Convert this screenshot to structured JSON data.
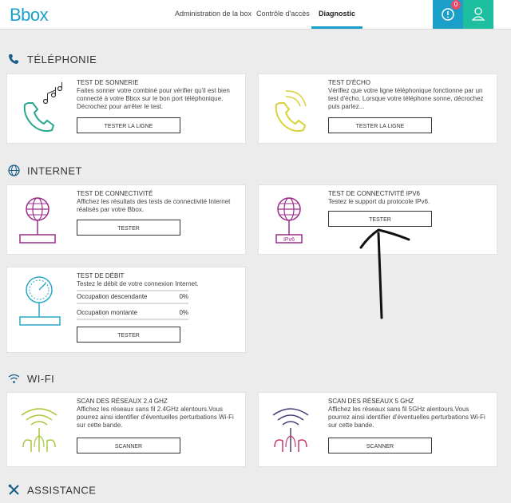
{
  "header": {
    "logo": "Bbox",
    "nav": [
      "Administration de la box",
      "Contrôle d'accès",
      "Diagnostic"
    ],
    "alert_count": "0",
    "colors": {
      "accent": "#1aa0c8",
      "user_button": "#1dbfa0",
      "badge": "#e84b6a"
    }
  },
  "sections": {
    "telephonie": "TÉLÉPHONIE",
    "internet": "INTERNET",
    "wifi": "WI-FI",
    "assistance": "ASSISTANCE"
  },
  "cards": {
    "sonnerie": {
      "title": "TEST DE SONNERIE",
      "desc": "Faites sonner votre combiné pour vérifier qu'il est bien connecté à votre Bbox sur le bon port téléphonique. Décrochez pour arrêter le test.",
      "action": "TESTER LA LIGNE",
      "icon": "phone-ringing-icon"
    },
    "echo": {
      "title": "TEST D'ÉCHO",
      "desc": "Vérifiez que votre ligne téléphonique fonctionne par un test d'écho. Lorsque votre téléphone sonne, décrochez puis parlez...",
      "action": "TESTER LA LIGNE",
      "icon": "phone-echo-icon"
    },
    "connectivite": {
      "title": "TEST DE CONNECTIVITÉ",
      "desc": "Affichez les résultats des tests de connectivité Internet réalisés par votre Bbox.",
      "action": "TESTER",
      "icon": "globe-box-icon"
    },
    "ipv6": {
      "title": "TEST DE CONNECTIVITÉ IPV6",
      "desc": "Testez le support du protocole IPv6.",
      "action": "TESTER",
      "icon": "globe-ipv6-icon",
      "icon_label": "IPv6"
    },
    "debit": {
      "title": "TEST DE DÉBIT",
      "desc": "Testez le débit de votre connexion Internet.",
      "down_label": "Occupation descendante",
      "down_value": "0%",
      "up_label": "Occupation montante",
      "up_value": "0%",
      "action": "TESTER",
      "icon": "speedometer-icon"
    },
    "wifi24": {
      "title": "SCAN DES RÉSEAUX 2.4 GHZ",
      "desc": "Affichez les réseaux sans fil 2.4GHz alentours.Vous pourrez ainsi identifier d'éventuelles perturbations Wi-Fi sur cette bande.",
      "action": "SCANNER",
      "icon": "wifi-antenna-icon"
    },
    "wifi5": {
      "title": "SCAN DES RÉSEAUX 5 GHZ",
      "desc": "Affichez les réseaux sans fil 5GHz alentours.Vous pourrez ainsi identifier d'éventuelles perturbations Wi-Fi sur cette bande.",
      "action": "SCANNER",
      "icon": "wifi-antenna-icon"
    }
  }
}
